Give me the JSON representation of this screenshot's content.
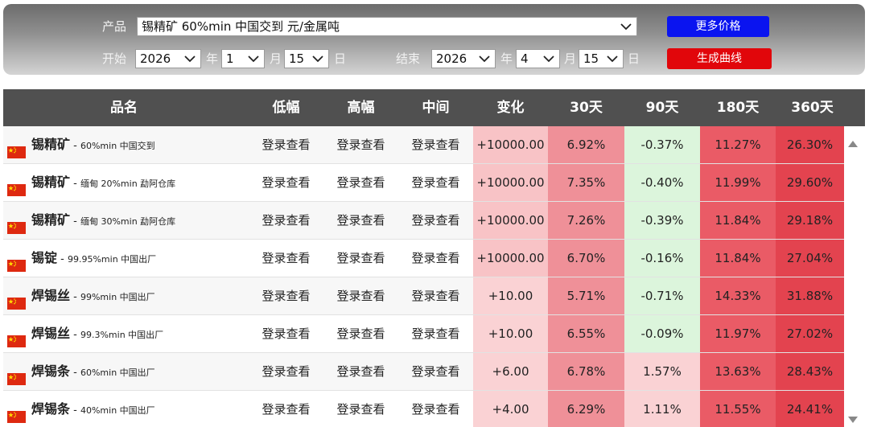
{
  "filter": {
    "product_label": "产品",
    "product_value": "锡精矿 60%min 中国交到 元/金属吨",
    "start_label": "开始",
    "end_label": "结束",
    "start": {
      "year": "2026",
      "month": "1",
      "day": "15"
    },
    "end": {
      "year": "2026",
      "month": "4",
      "day": "15"
    },
    "year_unit": "年",
    "month_unit": "月",
    "day_unit": "日",
    "more_prices_button": "更多价格",
    "generate_curve_button": "生成曲线",
    "colors": {
      "more_prices": "#0a14f0",
      "generate_curve": "#e1060b"
    }
  },
  "table": {
    "headers": {
      "name": "品名",
      "low": "低幅",
      "high": "高幅",
      "mid": "中间",
      "change": "变化",
      "d30": "30天",
      "d90": "90天",
      "d180": "180天",
      "d360": "360天"
    },
    "rows": [
      {
        "name": "锡精矿",
        "spec": "60%min 中国交到",
        "low": "登录查看",
        "high": "登录查看",
        "mid": "登录查看",
        "change": "+10000.00",
        "d30": "6.92%",
        "d90": "-0.37%",
        "d180": "11.27%",
        "d360": "26.30%"
      },
      {
        "name": "锡精矿",
        "spec": "缅甸 20%min 勐阿仓库",
        "low": "登录查看",
        "high": "登录查看",
        "mid": "登录查看",
        "change": "+10000.00",
        "d30": "7.35%",
        "d90": "-0.40%",
        "d180": "11.99%",
        "d360": "29.60%"
      },
      {
        "name": "锡精矿",
        "spec": "缅甸 30%min 勐阿仓库",
        "low": "登录查看",
        "high": "登录查看",
        "mid": "登录查看",
        "change": "+10000.00",
        "d30": "7.26%",
        "d90": "-0.39%",
        "d180": "11.84%",
        "d360": "29.18%"
      },
      {
        "name": "锡锭",
        "spec": "99.95%min 中国出厂",
        "low": "登录查看",
        "high": "登录查看",
        "mid": "登录查看",
        "change": "+10000.00",
        "d30": "6.70%",
        "d90": "-0.16%",
        "d180": "11.84%",
        "d360": "27.04%"
      },
      {
        "name": "焊锡丝",
        "spec": "99%min 中国出厂",
        "low": "登录查看",
        "high": "登录查看",
        "mid": "登录查看",
        "change": "+10.00",
        "d30": "5.71%",
        "d90": "-0.71%",
        "d180": "14.33%",
        "d360": "31.88%"
      },
      {
        "name": "焊锡丝",
        "spec": "99.3%min 中国出厂",
        "low": "登录查看",
        "high": "登录查看",
        "mid": "登录查看",
        "change": "+10.00",
        "d30": "6.55%",
        "d90": "-0.09%",
        "d180": "11.97%",
        "d360": "27.02%"
      },
      {
        "name": "焊锡条",
        "spec": "60%min 中国出厂",
        "low": "登录查看",
        "high": "登录查看",
        "mid": "登录查看",
        "change": "+6.00",
        "d30": "6.78%",
        "d90": "1.57%",
        "d180": "13.63%",
        "d360": "28.43%"
      },
      {
        "name": "焊锡条",
        "spec": "40%min 中国出厂",
        "low": "登录查看",
        "high": "登录查看",
        "mid": "登录查看",
        "change": "+4.00",
        "d30": "6.29%",
        "d90": "1.11%",
        "d180": "11.55%",
        "d360": "24.41%"
      }
    ],
    "colors": {
      "change_big": "#f8c3c6",
      "change_small": "#fad2d4",
      "d30": "#ef9098",
      "d90_negative": "#dcf5dc",
      "d90_positive": "#fad2d4",
      "d180": "#ea5b66",
      "d360": "#e3434f"
    }
  },
  "scrollbar": {
    "up_icon": "triangle-up-icon",
    "down_icon": "triangle-down-icon"
  }
}
